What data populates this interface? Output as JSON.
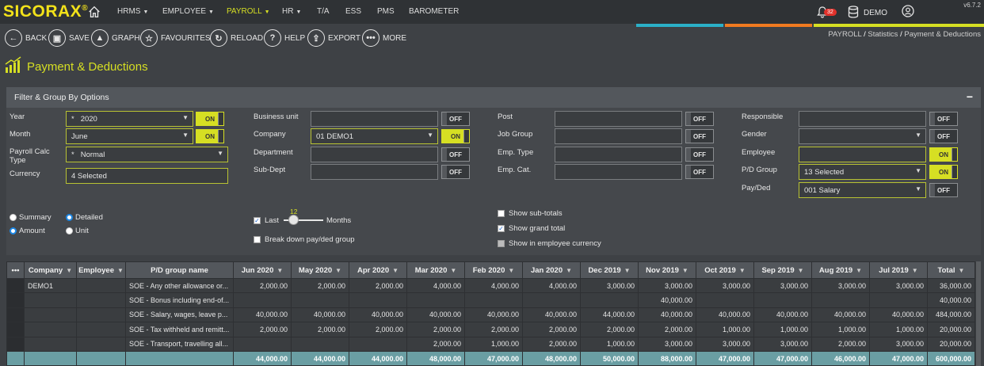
{
  "app": {
    "logo": "SICORAX",
    "logo_mark": "®",
    "version": "v6.7.2"
  },
  "nav": {
    "items": [
      {
        "label": "HRMS",
        "caret": true,
        "active": false
      },
      {
        "label": "EMPLOYEE",
        "caret": true,
        "active": false
      },
      {
        "label": "PAYROLL",
        "caret": true,
        "active": true
      },
      {
        "label": "HR",
        "caret": true,
        "active": false
      },
      {
        "label": "T/A",
        "caret": false,
        "active": false
      },
      {
        "label": "ESS",
        "caret": false,
        "active": false
      },
      {
        "label": "PMS",
        "caret": false,
        "active": false
      },
      {
        "label": "BAROMETER",
        "caret": false,
        "active": false
      }
    ],
    "notification_count": "32",
    "database_label": "DEMO"
  },
  "stripes": {
    "colors": [
      "#2bb0c8",
      "#f07a20",
      "#d6df23"
    ]
  },
  "toolbar": {
    "back": "BACK",
    "save": "SAVE",
    "graph": "GRAPH",
    "favourites": "FAVOURITES",
    "reload": "RELOAD",
    "help": "HELP",
    "export": "EXPORT",
    "more": "MORE"
  },
  "breadcrumb": {
    "l1": "PAYROLL",
    "l2": "Statistics",
    "l3": "Payment & Deductions",
    "sep": "/"
  },
  "page": {
    "title": "Payment & Deductions"
  },
  "filter": {
    "title": "Filter & Group By Options",
    "collapse": "−",
    "year_label": "Year",
    "year_value": "2020",
    "year_toggle": "ON",
    "month_label": "Month",
    "month_value": "June",
    "month_toggle": "ON",
    "calc_label": "Payroll Calc Type",
    "calc_value": "Normal",
    "currency_label": "Currency",
    "currency_value": "4 Selected",
    "bu_label": "Business unit",
    "bu_toggle": "OFF",
    "company_label": "Company",
    "company_value": "01 DEMO1",
    "company_toggle": "ON",
    "dept_label": "Department",
    "dept_toggle": "OFF",
    "subdept_label": "Sub-Dept",
    "subdept_toggle": "OFF",
    "post_label": "Post",
    "post_toggle": "OFF",
    "jobgroup_label": "Job Group",
    "jobgroup_toggle": "OFF",
    "emptype_label": "Emp. Type",
    "emptype_toggle": "OFF",
    "empcat_label": "Emp. Cat.",
    "empcat_toggle": "OFF",
    "resp_label": "Responsible",
    "resp_toggle": "OFF",
    "gender_label": "Gender",
    "gender_toggle": "OFF",
    "employee_label": "Employee",
    "employee_toggle": "ON",
    "pdgroup_label": "P/D Group",
    "pdgroup_value": "13 Selected",
    "pdgroup_toggle": "ON",
    "payded_label": "Pay/Ded",
    "payded_value": "001 Salary",
    "payded_toggle": "OFF",
    "summary": "Summary",
    "detailed": "Detailed",
    "amount": "Amount",
    "unit": "Unit",
    "last": "Last",
    "months": "Months",
    "months_value": "12",
    "breakdown": "Break down pay/ded group",
    "subtotals": "Show sub-totals",
    "grandtotal": "Show grand total",
    "empcurrency": "Show in employee currency",
    "selected_view": "Detailed",
    "selected_measure": "Amount",
    "checks": {
      "last": true,
      "breakdown": false,
      "subtotals": false,
      "grandtotal": true,
      "empcurrency": false
    }
  },
  "grid": {
    "columns": [
      "•••",
      "Company",
      "Employee",
      "P/D group name",
      "Jun 2020",
      "May 2020",
      "Apr 2020",
      "Mar 2020",
      "Feb 2020",
      "Jan 2020",
      "Dec 2019",
      "Nov 2019",
      "Oct 2019",
      "Sep 2019",
      "Aug 2019",
      "Jul 2019",
      "Total"
    ],
    "company": "DEMO1",
    "rows": [
      {
        "group": "SOE - Any other allowance or...",
        "values": [
          "2,000.00",
          "2,000.00",
          "2,000.00",
          "4,000.00",
          "4,000.00",
          "4,000.00",
          "3,000.00",
          "3,000.00",
          "3,000.00",
          "3,000.00",
          "3,000.00",
          "3,000.00",
          "36,000.00"
        ]
      },
      {
        "group": "SOE - Bonus including end-of...",
        "values": [
          "",
          "",
          "",
          "",
          "",
          "",
          "",
          "40,000.00",
          "",
          "",
          "",
          "",
          "40,000.00"
        ]
      },
      {
        "group": "SOE - Salary, wages, leave p...",
        "values": [
          "40,000.00",
          "40,000.00",
          "40,000.00",
          "40,000.00",
          "40,000.00",
          "40,000.00",
          "44,000.00",
          "40,000.00",
          "40,000.00",
          "40,000.00",
          "40,000.00",
          "40,000.00",
          "484,000.00"
        ]
      },
      {
        "group": "SOE - Tax withheld and remitt...",
        "values": [
          "2,000.00",
          "2,000.00",
          "2,000.00",
          "2,000.00",
          "2,000.00",
          "2,000.00",
          "2,000.00",
          "2,000.00",
          "1,000.00",
          "1,000.00",
          "1,000.00",
          "1,000.00",
          "20,000.00"
        ]
      },
      {
        "group": "SOE - Transport, travelling all...",
        "values": [
          "",
          "",
          "",
          "2,000.00",
          "1,000.00",
          "2,000.00",
          "1,000.00",
          "3,000.00",
          "3,000.00",
          "3,000.00",
          "2,000.00",
          "3,000.00",
          "20,000.00"
        ]
      }
    ],
    "totals": [
      "44,000.00",
      "44,000.00",
      "44,000.00",
      "48,000.00",
      "47,000.00",
      "48,000.00",
      "50,000.00",
      "88,000.00",
      "47,000.00",
      "47,000.00",
      "46,000.00",
      "47,000.00",
      "600,000.00"
    ]
  }
}
